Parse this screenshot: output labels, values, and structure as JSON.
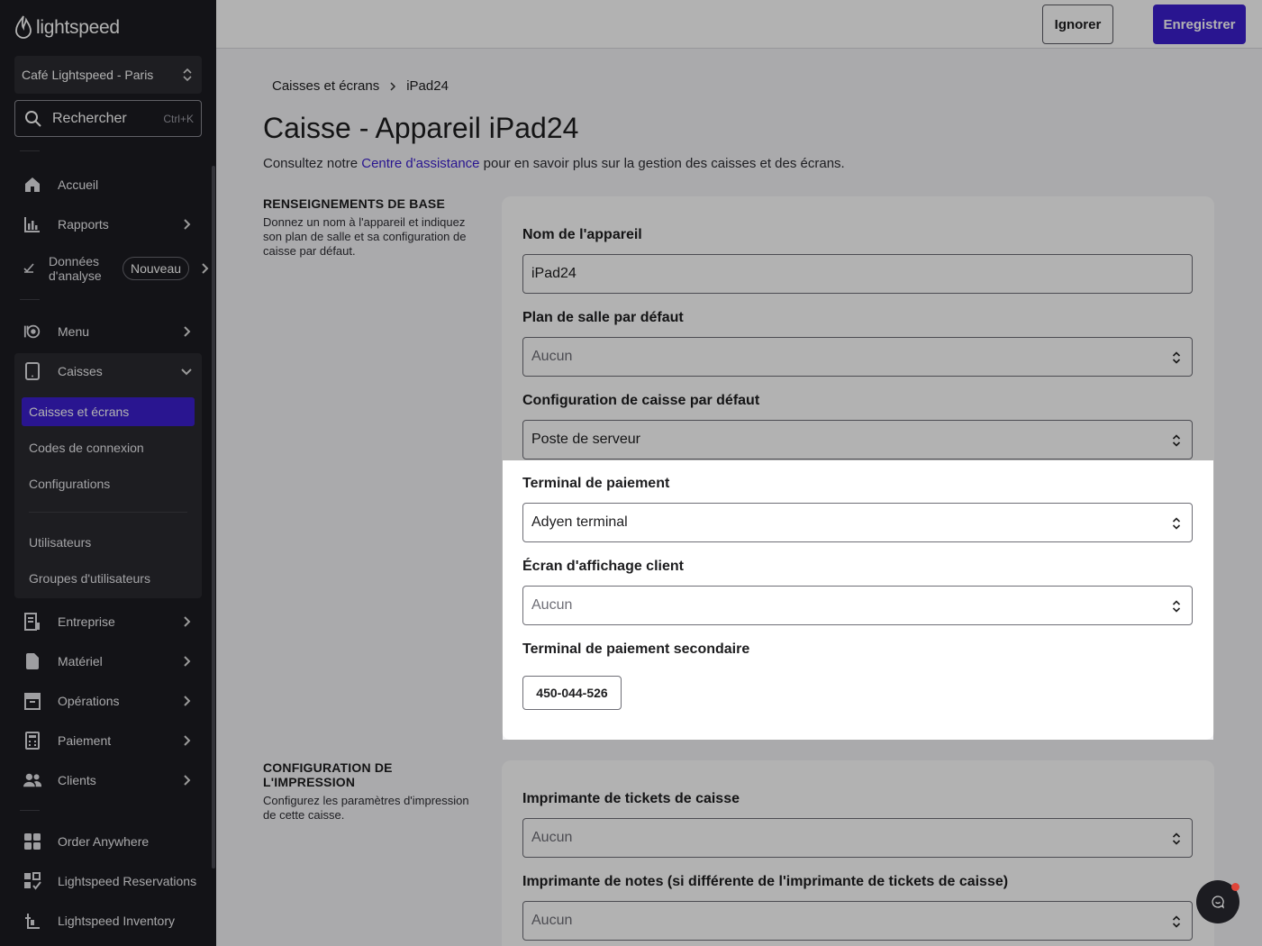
{
  "sidebar": {
    "brand": "lightspeed",
    "location": "Café Lightspeed - Paris",
    "search_label": "Rechercher",
    "search_shortcut": "Ctrl+K",
    "items": {
      "home": "Accueil",
      "reports": "Rapports",
      "analytics_line1": "Données",
      "analytics_line2": "d'analyse",
      "analytics_badge": "Nouveau",
      "menu": "Menu",
      "registers": "Caisses",
      "enterprise": "Entreprise",
      "hardware": "Matériel",
      "operations": "Opérations",
      "payment": "Paiement",
      "clients": "Clients",
      "order_anywhere": "Order Anywhere",
      "reservations": "Lightspeed Reservations",
      "inventory": "Lightspeed Inventory"
    },
    "registers_sub": {
      "screens": "Caisses et écrans",
      "login_codes": "Codes de connexion",
      "configurations": "Configurations",
      "users": "Utilisateurs",
      "user_groups": "Groupes d'utilisateurs"
    }
  },
  "topbar": {
    "ignore_label": "Ignorer",
    "save_label": "Enregistrer"
  },
  "breadcrumb": {
    "parent": "Caisses et écrans",
    "current": "iPad24"
  },
  "page": {
    "title": "Caisse - Appareil iPad24",
    "desc_before": "Consultez notre ",
    "desc_link": "Centre d'assistance",
    "desc_after": " pour en savoir plus sur la gestion des caisses et des écrans."
  },
  "basic_section": {
    "heading": "RENSEIGNEMENTS DE BASE",
    "description": "Donnez un nom à l'appareil et indiquez son plan de salle et sa configuration de caisse par défaut.",
    "device_name_label": "Nom de l'appareil",
    "device_name_value": "iPad24",
    "floor_plan_label": "Plan de salle par défaut",
    "floor_plan_value": "Aucun",
    "register_config_label": "Configuration de caisse par défaut",
    "register_config_value": "Poste de serveur",
    "payment_terminal_label": "Terminal de paiement",
    "payment_terminal_value": "Adyen terminal",
    "customer_display_label": "Écran d'affichage client",
    "customer_display_value": "Aucun",
    "secondary_terminal_label": "Terminal de paiement secondaire",
    "secondary_terminal_value": "450-044-526"
  },
  "print_section": {
    "heading": "CONFIGURATION DE L'IMPRESSION",
    "description": "Configurez les paramètres d'impression de cette caisse.",
    "receipt_printer_label": "Imprimante de tickets de caisse",
    "receipt_printer_value": "Aucun",
    "notes_printer_label": "Imprimante de notes (si différente de l'imprimante de tickets de caisse)",
    "notes_printer_value": "Aucun"
  },
  "colors": {
    "accent": "#3b1fcf",
    "sidebar_bg": "#1c1c21",
    "chat_dot": "#e0453a"
  }
}
